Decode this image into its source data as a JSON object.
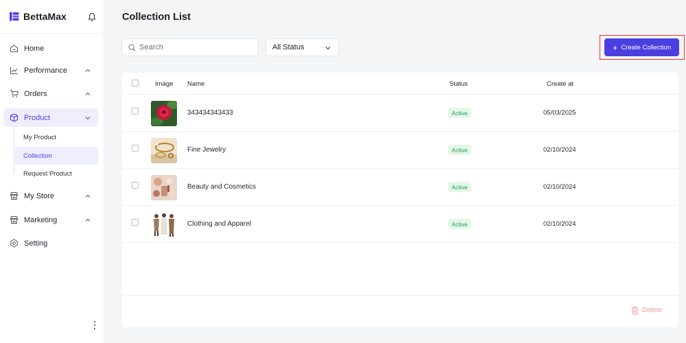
{
  "app": {
    "name": "BettaMax"
  },
  "sidebar": {
    "items": [
      {
        "label": "Home",
        "icon": "home-icon"
      },
      {
        "label": "Performance",
        "icon": "chart-icon"
      },
      {
        "label": "Orders",
        "icon": "cart-icon"
      },
      {
        "label": "Product",
        "icon": "box-icon",
        "expanded": true,
        "active": true
      },
      {
        "label": "My Store",
        "icon": "store-icon"
      },
      {
        "label": "Marketing",
        "icon": "store-icon"
      },
      {
        "label": "Setting",
        "icon": "gear-icon"
      }
    ],
    "product_submenu": [
      {
        "label": "My Product"
      },
      {
        "label": "Collection",
        "active": true
      },
      {
        "label": "Request Product"
      }
    ]
  },
  "page": {
    "title": "Collection List"
  },
  "toolbar": {
    "search_placeholder": "Search",
    "status_value": "All Status",
    "create_label": "Create Collection"
  },
  "table": {
    "headers": {
      "image": "Image",
      "name": "Name",
      "status": "Status",
      "created": "Create at"
    },
    "rows": [
      {
        "name": "343434343433",
        "status": "Active",
        "created": "05/03/2025",
        "thumb": "rose-image"
      },
      {
        "name": "Fine Jewelry",
        "status": "Active",
        "created": "02/10/2024",
        "thumb": "jewelry-image"
      },
      {
        "name": "Beauty and Cosmetics",
        "status": "Active",
        "created": "02/10/2024",
        "thumb": "cosmetics-image"
      },
      {
        "name": "Clothing and Apparel",
        "status": "Active",
        "created": "02/10/2024",
        "thumb": "apparel-image"
      }
    ]
  },
  "actions": {
    "delete_label": "Delete"
  },
  "colors": {
    "primary": "#4a3ee0",
    "active_bg": "#eeeefe",
    "success": "#1f9d55",
    "danger_soft": "#f19a9a",
    "highlight": "#e0342f"
  }
}
